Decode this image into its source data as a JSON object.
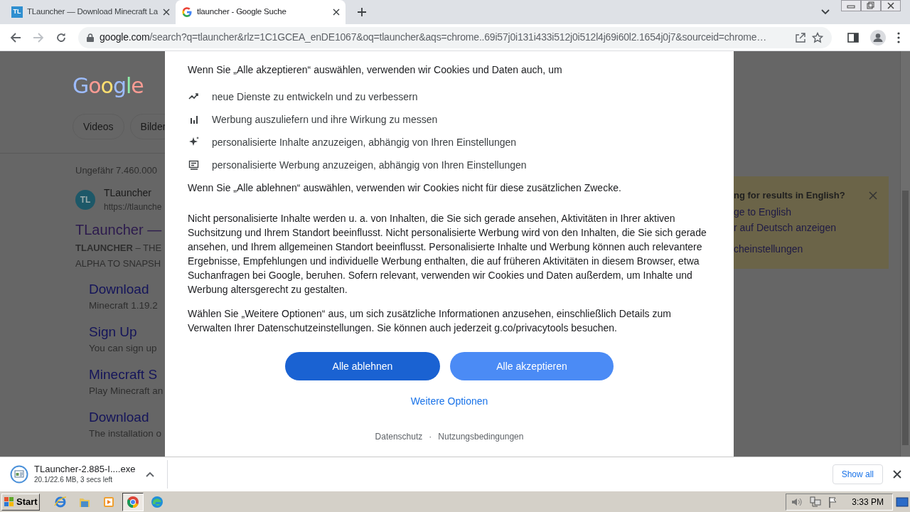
{
  "browser": {
    "tabs": [
      {
        "title": "TLauncher — Download Minecraft La",
        "favicon_text": "TL",
        "kind": "site",
        "selected": false
      },
      {
        "title": "tlauncher - Google Suche",
        "kind": "google",
        "selected": true
      }
    ],
    "address": {
      "host": "google.com",
      "path": "/search?q=tlauncher&rlz=1C1GCEA_enDE1067&oq=tlauncher&aqs=chrome..69i57j0i131i433i512j0i512l4j69i60l2.1654j0j7&sourceid=chrome…"
    }
  },
  "page_background": {
    "logo": "Google",
    "chips": [
      "Videos",
      "Bilder"
    ],
    "result_count": "Ungefähr 7.460.000",
    "result": {
      "favicon_text": "TL",
      "site_name": "TLauncher",
      "site_url": "https://tlaunche",
      "title": "TLauncher —",
      "snippet": [
        "**TLAUNCHER** – THE",
        "ALPHA TO SNAPSH"
      ],
      "sitelinks": [
        {
          "title": "Download",
          "snippet": "Minecraft 1.19.2"
        },
        {
          "title": "Sign Up",
          "snippet": "You can sign up"
        },
        {
          "title": "Minecraft S",
          "snippet": "Play Minecraft an"
        },
        {
          "title": "Download",
          "snippet": "The installation o"
        }
      ]
    },
    "language_panel": {
      "heading": "ng for results in English?",
      "links": [
        "ge to English",
        "r auf Deutsch anzeigen",
        "cheinstellungen"
      ]
    }
  },
  "dialog": {
    "intro": "Wenn Sie „Alle akzeptieren“ auswählen, verwenden wir Cookies und Daten auch, um",
    "purposes": [
      {
        "kind": "trend",
        "text": "neue Dienste zu entwickeln und zu verbessern"
      },
      {
        "kind": "bars",
        "text": "Werbung auszuliefern und ihre Wirkung zu messen"
      },
      {
        "kind": "sparkle",
        "text": "personalisierte Inhalte anzuzeigen, abhängig von Ihren Einstellungen"
      },
      {
        "kind": "feed",
        "text": "personalisierte Werbung anzuzeigen, abhängig von Ihren Einstellungen"
      }
    ],
    "outro": "Wenn Sie „Alle ablehnen“ auswählen, verwenden wir Cookies nicht für diese zusätzlichen Zwecke.",
    "paragraphs": [
      "Nicht personalisierte Inhalte werden u. a. von Inhalten, die Sie sich gerade ansehen, Aktivitäten in Ihrer aktiven Suchsitzung und Ihrem Standort beeinflusst. Nicht personalisierte Werbung wird von den Inhalten, die Sie sich gerade ansehen, und Ihrem allgemeinen Standort beeinflusst. Personalisierte Inhalte und Werbung können auch relevantere Ergebnisse, Empfehlungen und individuelle Werbung enthalten, die auf früheren Aktivitäten in diesem Browser, etwa Suchanfragen bei Google, beruhen. Sofern relevant, verwenden wir Cookies und Daten außerdem, um Inhalte und Werbung altersgerecht zu gestalten.",
      "Wählen Sie „Weitere Optionen“ aus, um sich zusätzliche Informationen anzusehen, einschließlich Details zum Verwalten Ihrer Datenschutzeinstellungen. Sie können auch jederzeit g.co/privacytools besuchen."
    ],
    "buttons": [
      {
        "label": "Alle ablehnen",
        "kind": "dark"
      },
      {
        "label": "Alle akzeptieren",
        "kind": "light"
      }
    ],
    "more_options": "Weitere Optionen",
    "footer_links": [
      "Datenschutz",
      "Nutzungsbedingungen"
    ],
    "footer_separator": "·"
  },
  "download_bar": {
    "filename": "TLauncher-2.885-I....exe",
    "status": "20.1/22.6 MB, 3 secs left",
    "show_all": "Show all"
  },
  "taskbar": {
    "start": "Start",
    "apps": [
      {
        "kind": "ie",
        "selected": false
      },
      {
        "kind": "folder",
        "selected": false
      },
      {
        "kind": "media",
        "selected": false
      },
      {
        "kind": "chrome",
        "selected": true
      },
      {
        "kind": "edge",
        "selected": false
      }
    ],
    "clock": "3:33 PM"
  }
}
